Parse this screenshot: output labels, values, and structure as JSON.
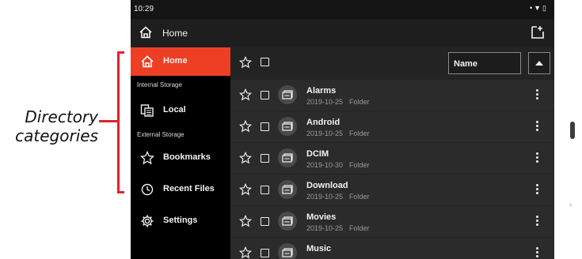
{
  "annotation": {
    "line1": "Directory",
    "line2": "categories",
    "color": "#e5202a"
  },
  "status_bar": {
    "time": "10:29"
  },
  "app_bar": {
    "title": "Home"
  },
  "sidebar": {
    "accent": "#ee3e24",
    "home_label": "Home",
    "internal_section": "Internal Storage",
    "local_label": "Local",
    "external_section": "External Storage",
    "bookmarks_label": "Bookmarks",
    "recent_label": "Recent Files",
    "settings_label": "Settings"
  },
  "toolbar": {
    "sort_label": "Name"
  },
  "files": [
    {
      "name": "Alarms",
      "date": "2019-10-25",
      "type": "Folder"
    },
    {
      "name": "Android",
      "date": "2019-10-25",
      "type": "Folder"
    },
    {
      "name": "DCIM",
      "date": "2019-10-30",
      "type": "Folder"
    },
    {
      "name": "Download",
      "date": "2019-10-25",
      "type": "Folder"
    },
    {
      "name": "Movies",
      "date": "2019-10-25",
      "type": "Folder"
    },
    {
      "name": "Music",
      "date": "",
      "type": ""
    }
  ]
}
